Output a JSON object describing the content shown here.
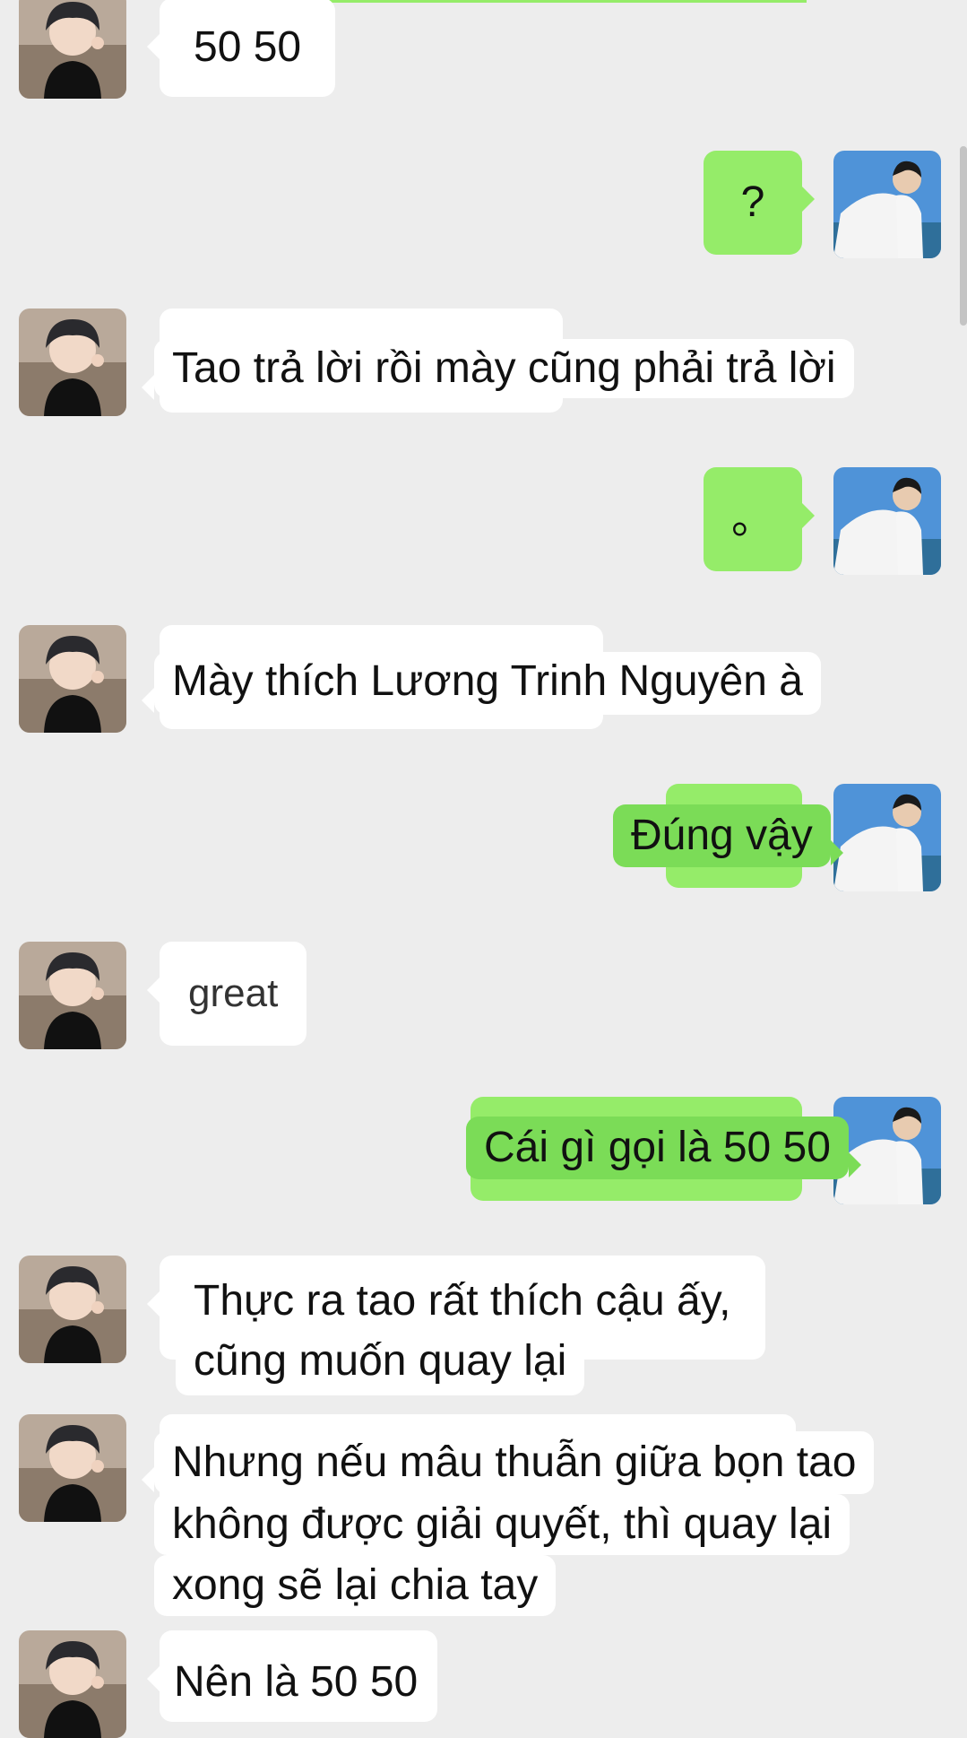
{
  "messages": [
    {
      "sender": "other",
      "text": "50 50"
    },
    {
      "sender": "me",
      "text": "?"
    },
    {
      "sender": "other",
      "text": "Tao trả lời rồi mày cũng phải trả lời"
    },
    {
      "sender": "me",
      "text": "。"
    },
    {
      "sender": "other",
      "text": "Mày thích Lương Trinh Nguyên à"
    },
    {
      "sender": "me",
      "text": "Đúng vậy"
    },
    {
      "sender": "other",
      "text": "great"
    },
    {
      "sender": "me",
      "text": "Cái gì gọi là 50 50"
    },
    {
      "sender": "other",
      "lines": [
        "Thực ra tao rất thích cậu ấy,",
        "cũng muốn quay lại"
      ]
    },
    {
      "sender": "other",
      "lines": [
        "Nhưng nếu mâu thuẫn giữa bọn tao",
        "không được giải quyết, thì quay lại",
        "xong sẽ lại chia tay"
      ]
    },
    {
      "sender": "other",
      "text": "Nên là 50 50"
    }
  ],
  "colors": {
    "background": "#ededed",
    "bubble_me": "#95ec69",
    "bubble_other": "#ffffff"
  }
}
